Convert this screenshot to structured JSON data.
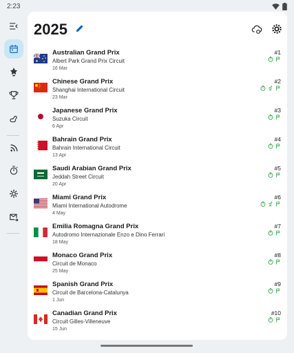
{
  "status_bar": {
    "time": "2:23"
  },
  "header": {
    "title": "2025"
  },
  "colors": {
    "accent": "#1565c0",
    "status_green": "#2e9e3e",
    "rail_active": "#c8e6f6"
  },
  "rail": {
    "items": [
      {
        "icon": "menu-collapse-icon"
      },
      {
        "icon": "calendar-icon",
        "active": true
      },
      {
        "icon": "standings-star-icon"
      },
      {
        "icon": "trophy-icon"
      },
      {
        "icon": "circuit-icon"
      },
      {
        "icon": "rss-feed-icon"
      },
      {
        "icon": "stopwatch-icon"
      },
      {
        "icon": "settings-gear-icon"
      },
      {
        "icon": "forward-email-icon"
      }
    ]
  },
  "races": [
    {
      "name": "Australian Grand Prix",
      "circuit": "Albert Park Grand Prix Circuit",
      "date": "16 Mar",
      "round": "#1",
      "flag": "au",
      "sprint": false
    },
    {
      "name": "Chinese Grand Prix",
      "circuit": "Shanghai International Circuit",
      "date": "23 Mar",
      "round": "#2",
      "flag": "cn",
      "sprint": true
    },
    {
      "name": "Japanese Grand Prix",
      "circuit": "Suzuka Circuit",
      "date": "6 Apr",
      "round": "#3",
      "flag": "jp",
      "sprint": false
    },
    {
      "name": "Bahrain Grand Prix",
      "circuit": "Bahrain International Circuit",
      "date": "13 Apr",
      "round": "#4",
      "flag": "bh",
      "sprint": false
    },
    {
      "name": "Saudi Arabian Grand Prix",
      "circuit": "Jeddah Street Circuit",
      "date": "20 Apr",
      "round": "#5",
      "flag": "sa",
      "sprint": false
    },
    {
      "name": "Miami Grand Prix",
      "circuit": "Miami International Autodrome",
      "date": "4 May",
      "round": "#6",
      "flag": "us",
      "sprint": true
    },
    {
      "name": "Emilia Romagna Grand Prix",
      "circuit": "Autodromo Internazionale Enzo e Dino Ferrari",
      "date": "18 May",
      "round": "#7",
      "flag": "it",
      "sprint": false
    },
    {
      "name": "Monaco Grand Prix",
      "circuit": "Circuit de Monaco",
      "date": "25 May",
      "round": "#8",
      "flag": "mc",
      "sprint": false
    },
    {
      "name": "Spanish Grand Prix",
      "circuit": "Circuit de Barcelona-Catalunya",
      "date": "1 Jun",
      "round": "#9",
      "flag": "es",
      "sprint": false
    },
    {
      "name": "Canadian Grand Prix",
      "circuit": "Circuit Gilles-Villeneuve",
      "date": "15 Jun",
      "round": "#10",
      "flag": "ca",
      "sprint": false
    }
  ]
}
